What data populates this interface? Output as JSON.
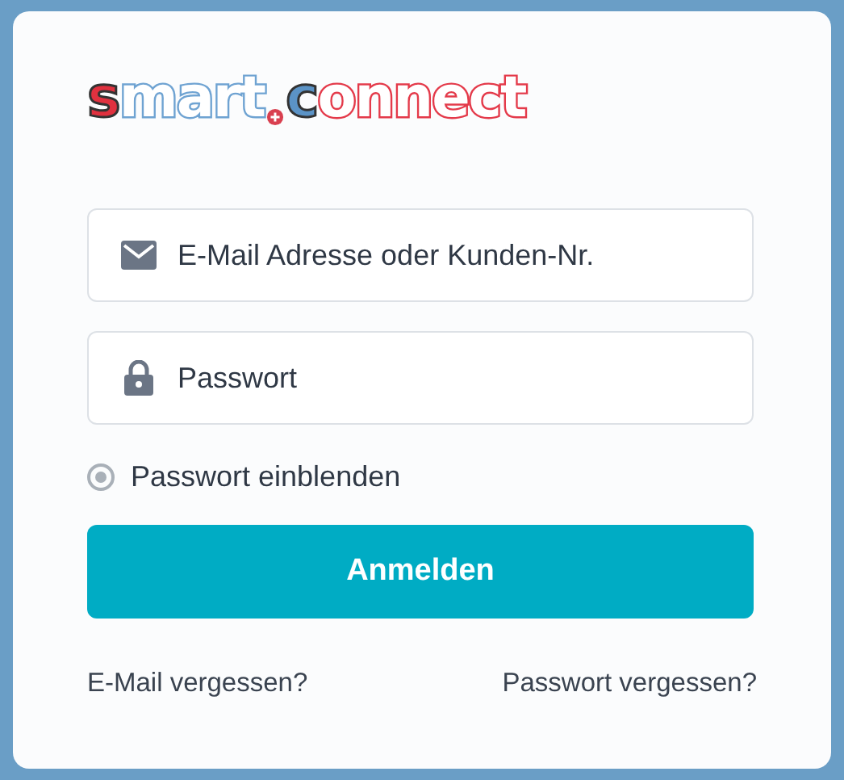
{
  "logo": {
    "parts": [
      {
        "text": "s",
        "kind": "filled"
      },
      {
        "text": "mart",
        "kind": "outline"
      },
      {
        "text": "c",
        "kind": "filled"
      },
      {
        "text": "onnect",
        "kind": "outline"
      }
    ]
  },
  "fields": [
    {
      "kind": "email",
      "placeholder": "E-Mail Adresse oder Kunden-Nr."
    },
    {
      "kind": "password",
      "placeholder": "Passwort"
    }
  ],
  "show_password": {
    "label": "Passwort einblenden",
    "checked": true
  },
  "submit_button": {
    "label": "Anmelden"
  },
  "links": [
    "E-Mail vergessen?",
    "Passwort vergessen?"
  ]
}
